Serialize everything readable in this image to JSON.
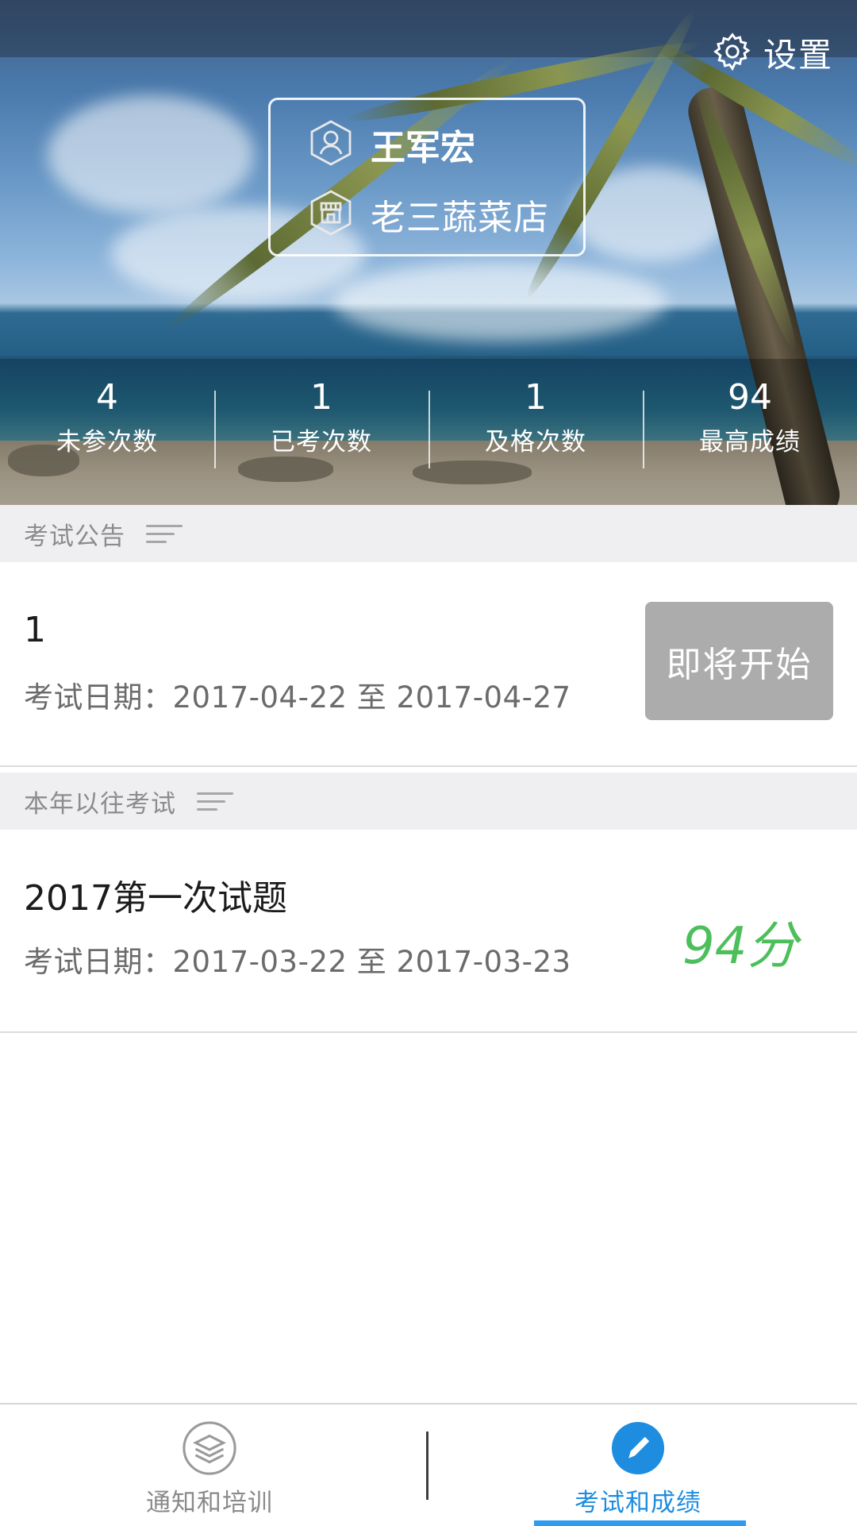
{
  "header": {
    "settings_label": "设置",
    "user_name": "王军宏",
    "store_name": "老三蔬菜店"
  },
  "stats": [
    {
      "value": "4",
      "label": "未参次数"
    },
    {
      "value": "1",
      "label": "已考次数"
    },
    {
      "value": "1",
      "label": "及格次数"
    },
    {
      "value": "94",
      "label": "最高成绩"
    }
  ],
  "announcements": {
    "title": "考试公告",
    "items": [
      {
        "title": "1",
        "date": "考试日期：2017-04-22 至 2017-04-27",
        "button_label": "即将开始"
      }
    ]
  },
  "past_exams": {
    "title": "本年以往考试",
    "items": [
      {
        "title": "2017第一次试题",
        "date": "考试日期：2017-03-22 至 2017-03-23",
        "score": "94分"
      }
    ]
  },
  "bottom_nav": {
    "items": [
      {
        "label": "通知和培训",
        "icon": "layers-icon",
        "active": false
      },
      {
        "label": "考试和成绩",
        "icon": "pencil-icon",
        "active": true
      }
    ]
  },
  "colors": {
    "accent": "#1e8de0",
    "score_green": "#4cbf5a",
    "disabled_button": "#acacac"
  }
}
